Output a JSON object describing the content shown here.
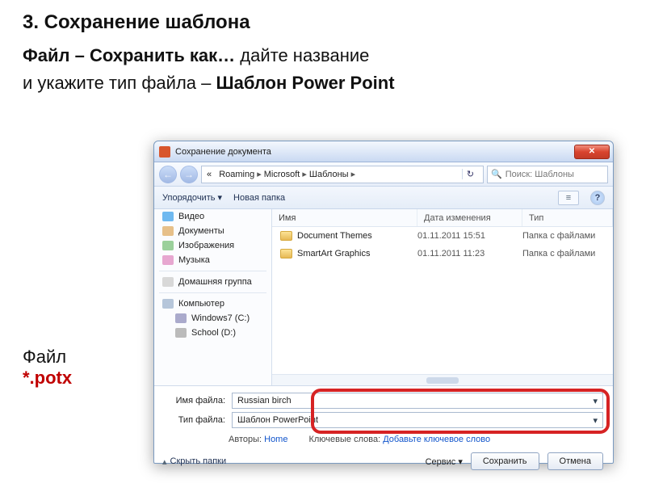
{
  "slide": {
    "title": "3. Сохранение шаблона",
    "line1_bold": "Файл – Сохранить как…",
    "line1_rest": " дайте название",
    "line2_pre": "и укажите тип файла – ",
    "line2_bold": "Шаблон Power Point",
    "file_label": "Файл",
    "file_ext": "*.potx"
  },
  "dialog": {
    "title": "Сохранение документа",
    "close_glyph": "✕",
    "nav_back": "←",
    "nav_fwd": "→",
    "breadcrumb": [
      "«",
      "Roaming",
      "Microsoft",
      "Шаблоны"
    ],
    "refresh_glyph": "↻",
    "search_placeholder": "Поиск: Шаблоны",
    "toolbar_organize": "Упорядочить ▾",
    "toolbar_newfolder": "Новая папка",
    "view_glyph": "≡",
    "help_glyph": "?",
    "columns": {
      "name": "Имя",
      "date": "Дата изменения",
      "type": "Тип"
    },
    "rows": [
      {
        "name": "Document Themes",
        "date": "01.11.2011 15:51",
        "type": "Папка с файлами"
      },
      {
        "name": "SmartArt Graphics",
        "date": "01.11.2011 11:23",
        "type": "Папка с файлами"
      }
    ],
    "sidebar": [
      {
        "icon": "i-vid",
        "label": "Видео"
      },
      {
        "icon": "i-doc",
        "label": "Документы"
      },
      {
        "icon": "i-img",
        "label": "Изображения"
      },
      {
        "icon": "i-mus",
        "label": "Музыка"
      }
    ],
    "sidebar2": [
      {
        "icon": "i-home",
        "label": "Домашняя группа"
      }
    ],
    "sidebar3": [
      {
        "icon": "i-comp",
        "label": "Компьютер"
      },
      {
        "icon": "i-drive",
        "label": "Windows7 (C:)",
        "indent": true
      },
      {
        "icon": "i-drive2",
        "label": "School (D:)",
        "indent": true
      }
    ],
    "filename_label": "Имя файла:",
    "filename_value": "Russian birch",
    "filetype_label": "Тип файла:",
    "filetype_value": "Шаблон PowerPoint",
    "authors_label": "Авторы:",
    "authors_value": "Home",
    "keywords_label": "Ключевые слова:",
    "keywords_value": "Добавьте ключевое слово",
    "hide_folders": "Скрыть папки",
    "tools_label": "Сервис ▾",
    "save_label": "Сохранить",
    "cancel_label": "Отмена"
  }
}
